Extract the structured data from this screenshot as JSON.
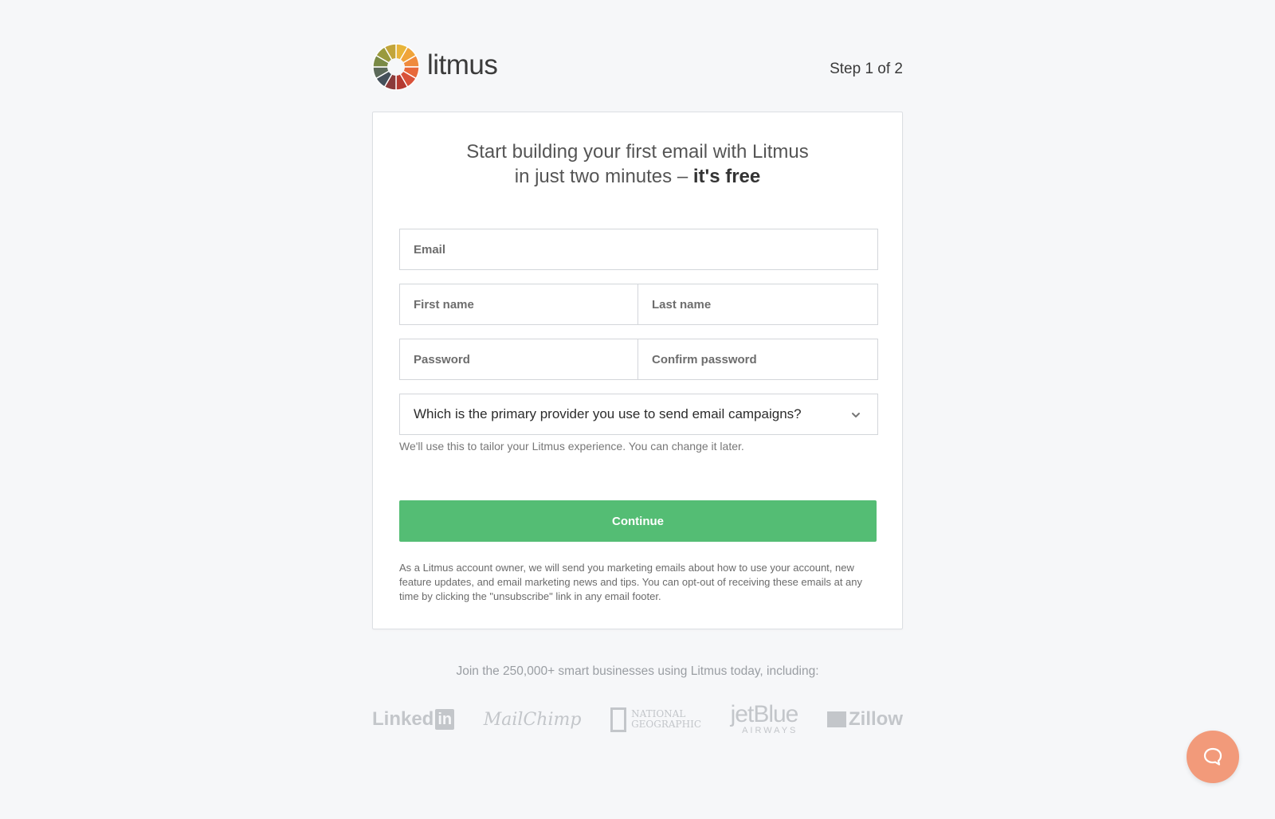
{
  "header": {
    "logo_text": "litmus",
    "step": "Step 1 of 2"
  },
  "form": {
    "headline_line1": "Start building your first email with Litmus",
    "headline_line2": "in just two minutes –",
    "headline_emphasis": "it's free",
    "email_placeholder": "Email",
    "first_name_placeholder": "First name",
    "last_name_placeholder": "Last name",
    "password_placeholder": "Password",
    "confirm_password_placeholder": "Confirm password",
    "provider_select": "Which is the primary provider you use to send email campaigns?",
    "provider_hint": "We'll use this to tailor your Litmus experience. You can change it later.",
    "continue_label": "Continue",
    "legal": "As a Litmus account owner, we will send you marketing emails about how to use your account, new feature updates, and email marketing news and tips. You can opt-out of receiving these emails at any time by clicking the \"unsubscribe\" link in any email footer."
  },
  "footer": {
    "join_text": "Join the 250,000+ smart businesses using Litmus today, including:",
    "brands": {
      "linkedin_a": "Linked",
      "linkedin_b": "in",
      "mailchimp": "MailChimp",
      "natgeo_a": "NATIONAL",
      "natgeo_b": "GEOGRAPHIC",
      "jetblue_a": "jetBlue",
      "jetblue_b": "AIRWAYS",
      "zillow": "Zillow"
    }
  },
  "colors": {
    "primary_button": "#54bd74",
    "chat_button": "#f29a7a",
    "background": "#f6f7f9"
  },
  "icons": {
    "logo": "litmus-wheel-logo",
    "select": "chevron-down-icon",
    "chat": "chat-bubble-icon"
  }
}
